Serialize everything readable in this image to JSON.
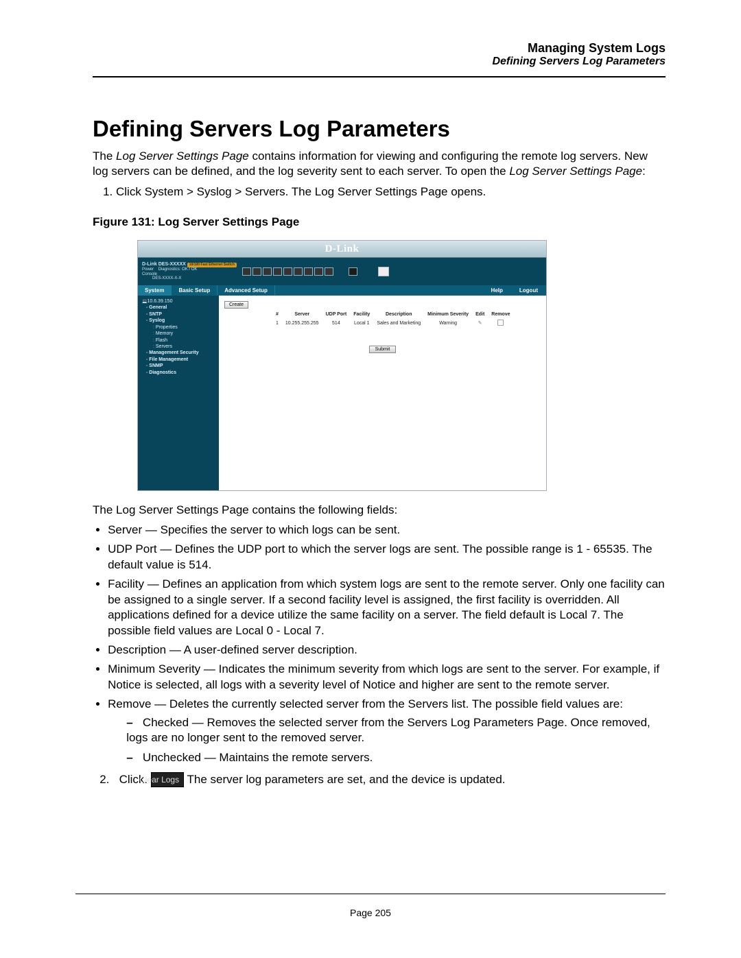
{
  "header": {
    "section": "Managing System Logs",
    "subsection": "Defining Servers Log Parameters"
  },
  "title": "Defining Servers Log Parameters",
  "intro": {
    "p1_a": "The ",
    "p1_b": "Log Server Settings Page",
    "p1_c": " contains information for viewing and configuring the remote log servers. New log servers can be defined, and the log severity sent to each server. To open the ",
    "p1_d": "Log Server Settings Page",
    "p1_e": ":"
  },
  "step1": {
    "a": "Click ",
    "b": "System > Syslog > Servers",
    "c": ". The ",
    "d": "Log Server Settings Page",
    "e": " opens."
  },
  "figure_caption": "Figure 131: Log Server Settings Page",
  "figure": {
    "brand": "D-Link",
    "device_line1": "D-Link DES-XXXXX",
    "device_tag": "10/100 Fast Ethernet Switch",
    "device_lines": "Power    Diagnostics: OK / OK\nConsole    \n         DES-XXXX-X-X",
    "modebar": {
      "sys": "System",
      "basic": "Basic Setup",
      "adv": "Advanced Setup",
      "help": "Help",
      "logout": "Logout"
    },
    "sidebar": {
      "root": "10.6.39.150",
      "items": [
        {
          "label": "General",
          "level": 1
        },
        {
          "label": "SNTP",
          "level": 1
        },
        {
          "label": "Syslog",
          "level": 1
        },
        {
          "label": "Properties",
          "level": 2
        },
        {
          "label": "Memory",
          "level": 2
        },
        {
          "label": "Flash",
          "level": 2
        },
        {
          "label": "Servers",
          "level": 2
        },
        {
          "label": "Management Security",
          "level": 1
        },
        {
          "label": "File Management",
          "level": 1
        },
        {
          "label": "SNMP",
          "level": 1
        },
        {
          "label": "Diagnostics",
          "level": 1
        }
      ]
    },
    "main": {
      "create": "Create",
      "submit": "Submit",
      "columns": [
        "#",
        "Server",
        "UDP Port",
        "Facility",
        "Description",
        "Minimum Severity",
        "Edit",
        "Remove"
      ],
      "row": {
        "n": "1",
        "server": "10.255.255.255",
        "port": "514",
        "facility": "Local 1",
        "desc": "Sales and Marketing",
        "sev": "Warning"
      }
    }
  },
  "fields_lead_a": "The ",
  "fields_lead_b": "Log Server Settings Page",
  "fields_lead_c": " contains the following fields:",
  "fields": {
    "server": {
      "name": "Server",
      "desc": " — Specifies the server to which logs can be sent."
    },
    "udp": {
      "name": "UDP Port",
      "desc": " — Defines the UDP port to which the server logs are sent. The possible range is 1 - 65535. The default value is 514."
    },
    "facility": {
      "name": "Facility",
      "desc_a": " — Defines an application from which system logs are sent to the remote server. Only one facility can be assigned to a single server. If a second facility level is assigned, the first facility is overridden. All applications defined for a device utilize the same facility on a server. The field default is Local 7. The possible field values are ",
      "desc_b": "Local 0 - Local 7",
      "desc_c": "."
    },
    "description": {
      "name": "Description",
      "desc": " — A user-defined server description."
    },
    "minsev": {
      "name": "Minimum Severity",
      "desc_a": " — Indicates the minimum severity from which logs are sent to the server. For example, if ",
      "desc_b": "Notice",
      "desc_c": " is selected, all logs with a severity level of ",
      "desc_d": "Notice",
      "desc_e": " and higher are sent to the remote server."
    },
    "remove": {
      "name": "Remove",
      "desc": " — Deletes the currently selected server from the Servers list. The possible field values are:",
      "checked": {
        "label": "Checked",
        "a": " — Removes the selected server from the ",
        "b": "Servers Log Parameters Page",
        "c": ". Once removed, logs are no longer sent to the removed server."
      },
      "unchecked": {
        "label": "Unchecked",
        "desc": " — Maintains the remote servers."
      }
    }
  },
  "step2": {
    "num": "2.",
    "a": "Click.",
    "button": "Clear Logs",
    "b": "The server log parameters are set, and the device is updated."
  },
  "page_number": "Page 205"
}
